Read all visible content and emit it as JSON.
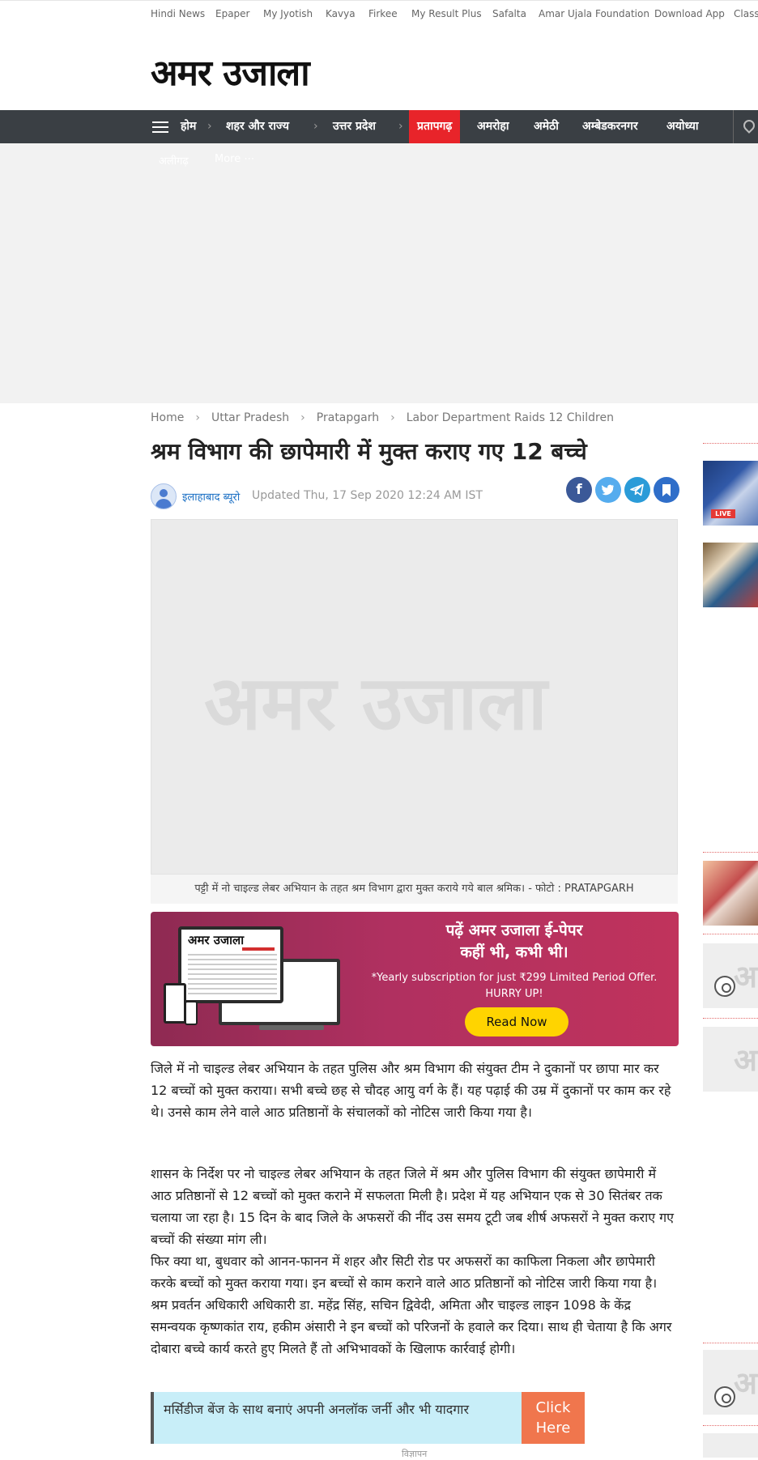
{
  "top_links": [
    "Hindi News",
    "Epaper",
    "My Jyotish",
    "Kavya",
    "Firkee",
    "My Result Plus",
    "Safalta",
    "Amar Ujala Foundation",
    "Download App",
    "Class"
  ],
  "logo": "अमर उजाला",
  "nav": {
    "breadcrumb_items": [
      "होम",
      "शहर और राज्य",
      "उत्तर प्रदेश"
    ],
    "active_city": "प्रतापगढ़",
    "cities": [
      "अमरोहा",
      "अमेठी",
      "अम्बेडकरनगर",
      "अयोध्या"
    ],
    "sub_items": [
      "अलीगढ़",
      "More ⋯"
    ]
  },
  "breadcrumb": [
    "Home",
    "Uttar Pradesh",
    "Pratapgarh",
    "Labor Department Raids 12 Children"
  ],
  "headline": "श्रम विभाग की छापेमारी में मुक्त कराए गए 12 बच्चे",
  "author": "इलाहाबाद ब्यूरो",
  "updated": "Updated Thu, 17 Sep 2020 12:24 AM IST",
  "share_icons": [
    "facebook-icon",
    "twitter-icon",
    "telegram-icon",
    "bookmark-icon"
  ],
  "photo_watermark": "अमर उजाला",
  "caption": "पट्टी में नो चाइल्ड लेबर अभियान के तहत श्रम विभाग द्वारा मुक्त कराये गये बाल श्रमिक। - फोटो : PRATAPGARH",
  "promo": {
    "device_logo": "अमर उजाला",
    "title_line1": "पढ़ें अमर उजाला ई-पेपर",
    "title_line2": "कहीं भी, कभी भी।",
    "offer_line1": "*Yearly subscription for just ₹299 Limited Period Offer.",
    "offer_line2": "HURRY UP!",
    "button": "Read Now",
    "colors": {
      "bg_start": "#8e2a52",
      "bg_end": "#c0335c",
      "button": "#ffd400"
    }
  },
  "article": {
    "para1": "जिले में नो चाइल्ड लेबर अभियान के तहत पुलिस और श्रम विभाग की संयुक्त टीम ने दुकानों पर छापा मार कर 12 बच्चों को मुक्त कराया। सभी बच्चे छह से चौदह आयु वर्ग के हैं। यह पढ़ाई की उम्र में दुकानों पर काम कर रहे थे। उनसे काम लेने वाले आठ प्रतिष्ठानों के संचालकों को नोटिस जारी किया गया है।",
    "para2": "शासन के निर्देश पर नो चाइल्ड लेबर अभियान के तहत जिले में श्रम और पुलिस विभाग की संयुक्त छापेमारी में आठ प्रतिष्ठानों से 12 बच्चों को मुक्त कराने में सफलता मिली है। प्रदेश में यह अभियान एक से 30 सितंबर तक चलाया जा रहा है। 15 दिन के बाद जिले के अफसरों की नींद उस समय टूटी जब शीर्ष अफसरों ने मुक्त कराए गए बच्चों की संख्या मांग ली।",
    "para3": "फिर क्या था, बुधवार को आनन-फानन में शहर और सिटी रोड पर अफसरों का काफिला निकला और छापेमारी करके बच्चों को मुक्त कराया गया। इन बच्चों से काम कराने वाले आठ प्रतिष्ठानों को नोटिस जारी किया गया है। श्रम प्रवर्तन अधिकारी अधिकारी डा. महेंद्र सिंह, सचिन द्विवेदी, अमिता और चाइल्ड लाइन 1098 के केंद्र समन्वयक कृष्णकांत राय, हकीम अंसारी ने इन बच्चों को परिजनों के हवाले कर दिया। साथ ही चेताया है कि अगर दोबारा बच्चे कार्य करते हुए मिलते हैं तो अभिभावकों के खिलाफ कार्रवाई होगी।"
  },
  "mercedes_ad": {
    "text": "मर्सिडीज बेंज के साथ बनाएं अपनी अनलॉक जर्नी और भी यादगार",
    "button_line1": "Click",
    "button_line2": "Here"
  },
  "below_ad_label": "विज्ञापन",
  "rail_placeholder": "अ",
  "rail_thumb_badge": "LIVE"
}
